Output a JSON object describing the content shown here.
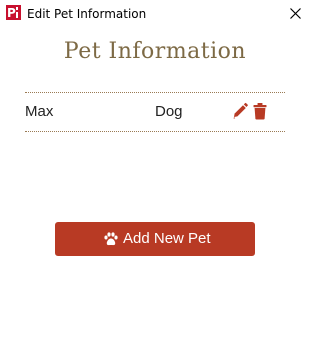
{
  "window": {
    "title": "Edit Pet Information",
    "icon": "app-logo-icon",
    "close_icon": "close-icon"
  },
  "header": {
    "title": "Pet Information"
  },
  "pets": [
    {
      "name": "Max",
      "type": "Dog",
      "edit_icon": "pencil-icon",
      "delete_icon": "trash-icon"
    }
  ],
  "actions": {
    "add_label": "Add New Pet",
    "add_icon": "paw-icon"
  },
  "colors": {
    "accent": "#b83a24",
    "title": "#7d6a45",
    "divider": "#9a7a54"
  }
}
